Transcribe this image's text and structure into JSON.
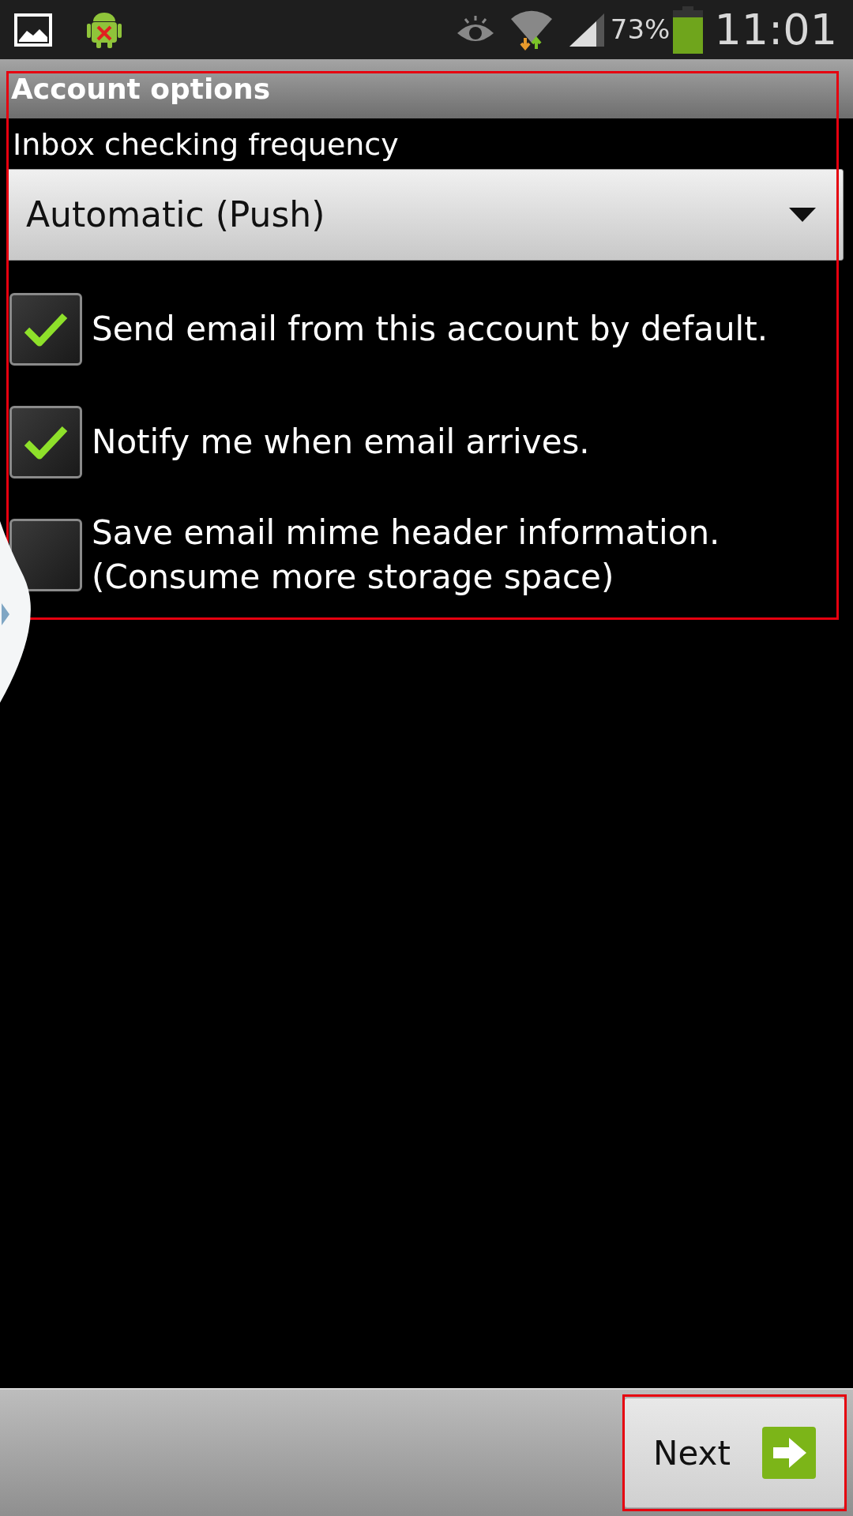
{
  "status_bar": {
    "battery": "73%",
    "time": "11:01"
  },
  "header": {
    "title": "Account options"
  },
  "options": {
    "highlighted": true,
    "frequency_label": "Inbox checking frequency",
    "frequency_dropdown": {
      "value": "Automatic (Push)"
    },
    "checkboxes": [
      {
        "label": "Send email from this account by default.",
        "checked": true
      },
      {
        "label": "Notify me when email arrives.",
        "checked": true
      },
      {
        "label": "Save email mime header information.\n(Consume more storage space)",
        "checked": false
      }
    ]
  },
  "footer": {
    "next_button": {
      "label": "Next",
      "highlighted": true
    }
  }
}
